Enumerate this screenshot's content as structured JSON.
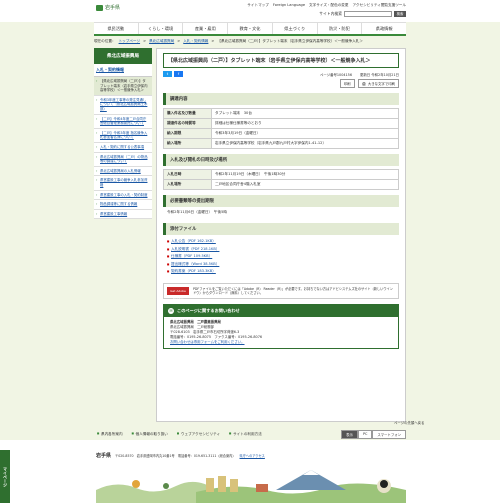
{
  "header": {
    "logo_text": "岩手県",
    "util_links": [
      "サイトマップ",
      "Foreign Language",
      "文字サイズ・配色の変更",
      "アクセシビリティ閲覧支援ツール"
    ],
    "search_label": "サイト内検索",
    "search_button": "検索"
  },
  "gnav": [
    "県民活動",
    "くらし・環境",
    "産業・雇用",
    "教育・文化",
    "県土づくり",
    "防災・防犯",
    "県政情報"
  ],
  "breadcrumb": {
    "prefix": "現在の位置：",
    "items": [
      "トップページ",
      "県北広域振興局",
      "入札・契約情報"
    ],
    "current": "【県北広域振興局（二戸）】タブレット端末（岩手県立伊保内高等学校）＜一般競争入札＞"
  },
  "sidebar": {
    "title": "県北広域振興局",
    "subtitle": "入札・契約情報",
    "items": [
      {
        "label": "【県北広域振興局（二戸）】タブレット端末（岩手県立伊保内高等学校）＜一般競争入札＞",
        "current": true
      },
      {
        "label": "令和3年度工事等の発注見通しについて（県北広域振興局土木部）",
        "current": false
      },
      {
        "label": "【二戸】令和4年度二戸合同庁舎総合管理業務委託について",
        "current": false
      },
      {
        "label": "【二戸】令和3年度 指名競争入札参加者名簿について",
        "current": false
      },
      {
        "label": "入札・契約に関する公表事項",
        "current": false
      },
      {
        "label": "県北広域振興局（二戸）の物品等の調達について",
        "current": false
      },
      {
        "label": "県北広域振興局の入札情報",
        "current": false
      },
      {
        "label": "県営建設工事の競争入札参加資格",
        "current": false
      },
      {
        "label": "県営建設工事の入札・契約制度",
        "current": false
      },
      {
        "label": "物品調達等に関する情報",
        "current": false
      },
      {
        "label": "県営建設工事情報",
        "current": false
      }
    ]
  },
  "main": {
    "title": "【県北広域振興局（二戸）】タブレット端末（岩手県立伊保内高等学校）＜一般競争入札＞",
    "page_no": "ページ番号1004156",
    "updated": "更新日 令和2年10月21日",
    "print_label": "印刷",
    "font_label": "大きな文字で印刷",
    "sections": {
      "procurement": "調達内容",
      "schedule": "入札及び開札の日時及び場所",
      "deadline": "必要書類等の提出期限",
      "files": "添付ファイル"
    },
    "procurement_rows": [
      {
        "k": "購入件名及び数量",
        "v": "タブレット端末　30台"
      },
      {
        "k": "調達件名の特質等",
        "v": "詳細は仕様仕様書等のとおり"
      },
      {
        "k": "納入期限",
        "v": "令和3年3月19日（金曜日）"
      },
      {
        "k": "納入場所",
        "v": "岩手県立伊保内高等学校（岩手県九戸郡九戸村大字伊保内1-41-12）"
      }
    ],
    "schedule_rows": [
      {
        "k": "入札日時",
        "v": "令和2年11月19日（木曜日）　午後1時30分"
      },
      {
        "k": "入札場所",
        "v": "二戸地区合同庁舎4階入札室"
      }
    ],
    "deadline_text": "令和2年11月6日（金曜日）　午後5時",
    "files": [
      "入札公告（PDF 162.1KB）",
      "入札説明書（PDF 218.1KB）",
      "仕様書（PDF 109.5KB）",
      "提出様式等（Word 38.5KB）",
      "契約書案（PDF 183.3KB）"
    ],
    "acrobat_icon": "Get Adobe Reader",
    "acrobat_text": "PDFファイルをご覧いただくには「Adobe（R） Reader（R）」が必要です。お持ちでない方はアドビシステムズ社のサイト（新しいウインドウ）からダウンロード（無料）してください。",
    "acrobat_link": "アドビシステムズ社のサイト（新しいウインドウ）",
    "contact": {
      "heading": "このページに関するお問い合わせ",
      "org": "県北広域振興局　二戸農業振興局",
      "dept": "県北広域振興局　二戸総務部",
      "postal": "〒028-6103　岩手県二戸市石切所字荷渡6-3",
      "tel": "電話番号：0195-26-8075　ファクス番号：0195-26-8076",
      "form_link": "お問い合わせは専用フォームをご利用ください。"
    }
  },
  "footer_links": {
    "links": [
      "県内各所案内",
      "個人情報の取り扱い",
      "ウェブアクセシビリティ",
      "サイトの利用方法"
    ],
    "mode_pc": "PC",
    "mode_sp": "スマートフォン",
    "mode_label": "表示",
    "pagetop": "ページの先頭へ戻る"
  },
  "footer": {
    "name": "岩手県",
    "address": "〒020-8570　岩手県盛岡市内丸10番1号　電話番号：019-651-3111（総合案内）",
    "link": "県庁へのアクセス"
  },
  "mypage": "マイページ"
}
